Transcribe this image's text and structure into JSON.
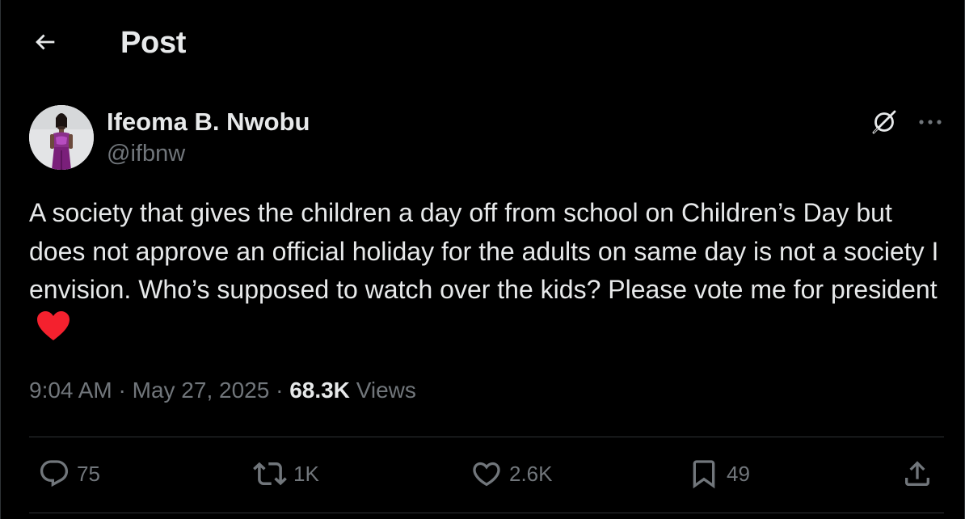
{
  "header": {
    "back_icon": "arrow-left-icon",
    "title": "Post"
  },
  "author": {
    "name": "Ifeoma B. Nwobu",
    "handle": "@ifbnw",
    "grok_icon": "grok-icon",
    "more_icon": "more-horizontal-icon"
  },
  "post": {
    "text": "A society that gives the children a day off from school on Children’s Day but does not approve an official holiday for the adults on same day is not a society I envision. Who’s supposed to watch over the kids? Please vote me for president",
    "emoji": "red-heart-emoji"
  },
  "meta": {
    "time": "9:04 AM",
    "separator": "·",
    "date": "May 27, 2025",
    "views_count": "68.3K",
    "views_label": "Views"
  },
  "actions": {
    "replies": "75",
    "reposts": "1K",
    "likes": "2.6K",
    "bookmarks": "49"
  },
  "colors": {
    "background": "#000000",
    "text_primary": "#e7e9ea",
    "text_secondary": "#71767b",
    "divider": "#2f3336",
    "heart": "#f4212e"
  }
}
